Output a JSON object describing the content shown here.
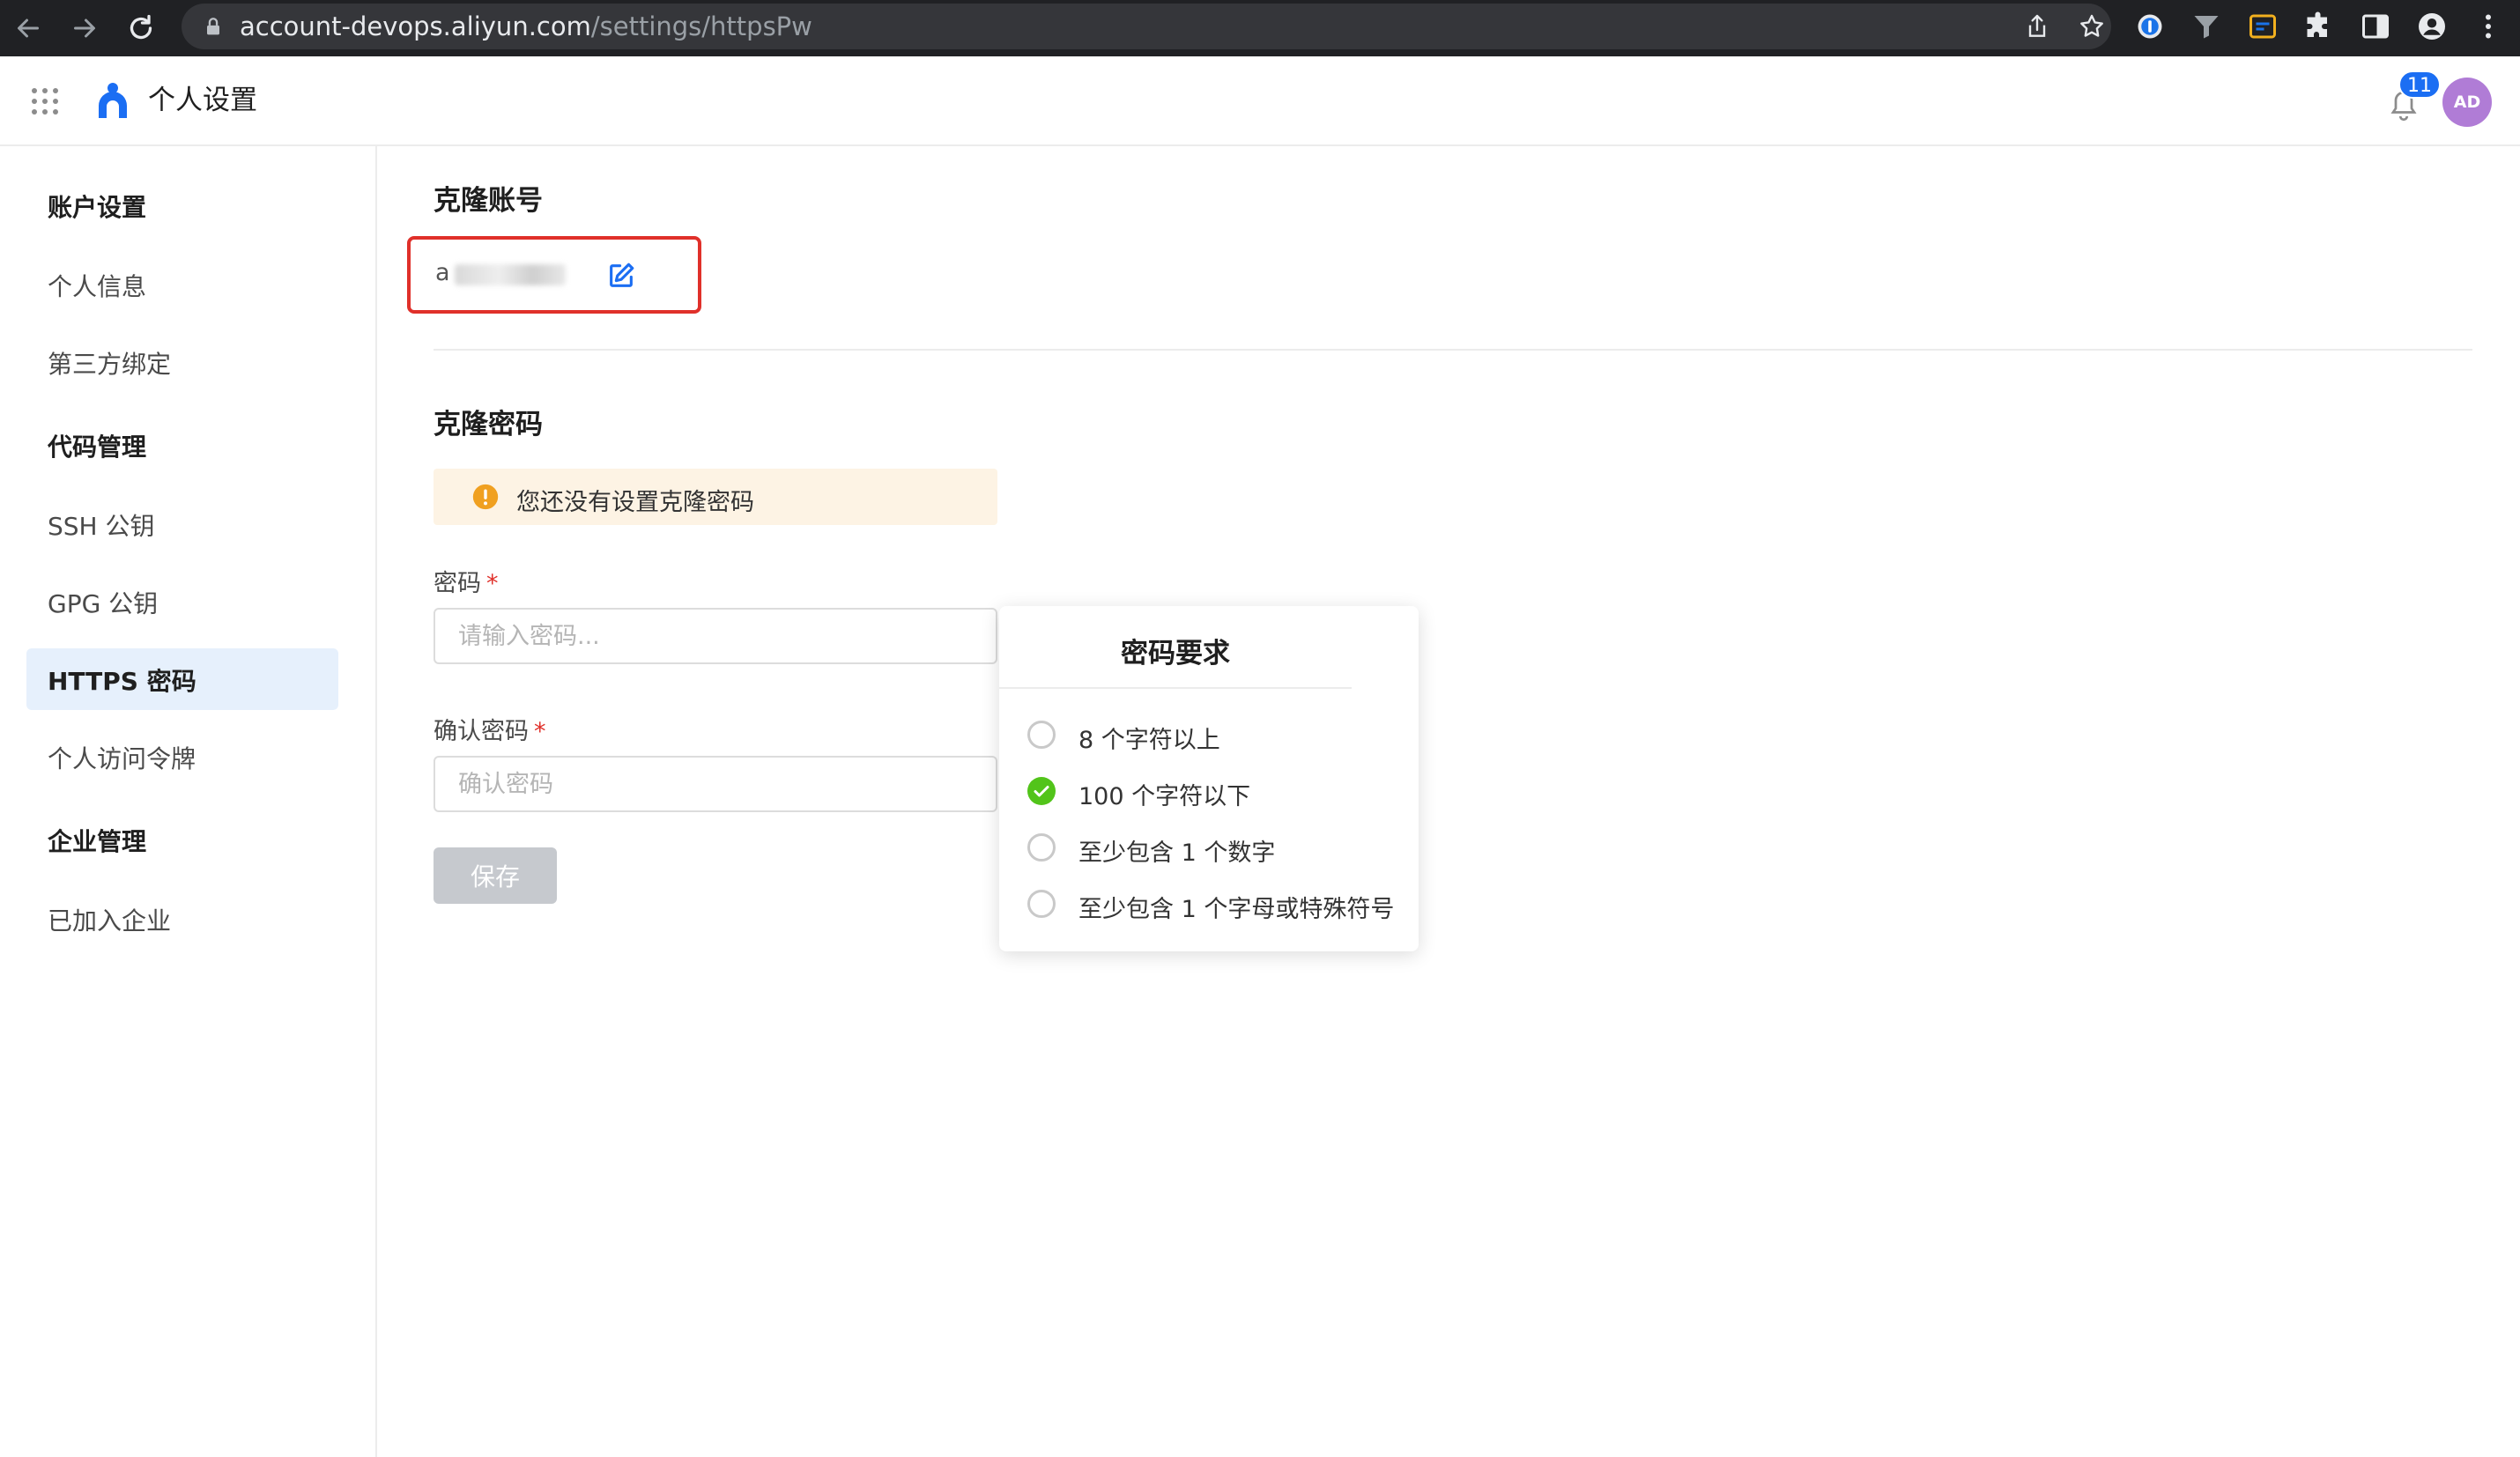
{
  "browser": {
    "url_host": "account-devops.aliyun.com",
    "url_path": "/settings/httpsPw"
  },
  "header": {
    "title": "个人设置",
    "notification_count": "11",
    "avatar_initials": "AD"
  },
  "sidebar": {
    "sections": [
      {
        "heading": "账户设置",
        "items": [
          "个人信息",
          "第三方绑定"
        ]
      },
      {
        "heading": "代码管理",
        "items": [
          "SSH 公钥",
          "GPG 公钥",
          "HTTPS 密码",
          "个人访问令牌"
        ]
      },
      {
        "heading": "企业管理",
        "items": [
          "已加入企业"
        ]
      }
    ],
    "active_item": "HTTPS 密码"
  },
  "main": {
    "clone_account": {
      "title": "克隆账号",
      "value_visible_prefix": "a"
    },
    "clone_password": {
      "title": "克隆密码",
      "warning": "您还没有设置克隆密码",
      "password_label": "密码",
      "password_placeholder": "请输入密码...",
      "confirm_label": "确认密码",
      "confirm_placeholder": "确认密码",
      "required_mark": "*",
      "save_label": "保存"
    }
  },
  "popover": {
    "title": "密码要求",
    "requirements": [
      {
        "text": "8 个字符以上",
        "met": false
      },
      {
        "text": "100 个字符以下",
        "met": true
      },
      {
        "text": "至少包含 1 个数字",
        "met": false
      },
      {
        "text": "至少包含 1 个字母或特殊符号",
        "met": false
      }
    ]
  },
  "colors": {
    "accent": "#1b6ef3",
    "highlight_border": "#e0302a",
    "success": "#52c41a",
    "warning": "#f0a020",
    "active_bg": "#e6f0fc"
  }
}
